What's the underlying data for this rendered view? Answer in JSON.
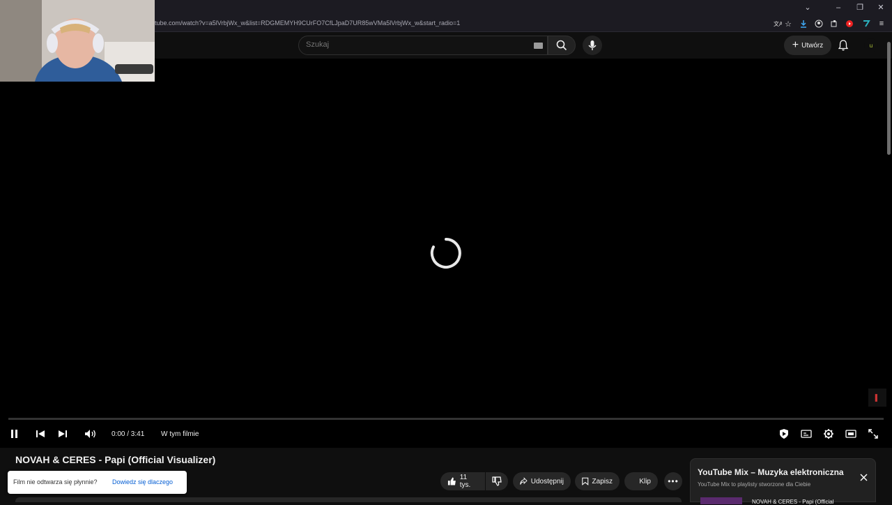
{
  "browser": {
    "url": "tube.com/watch?v=a5lVrbjWx_w&list=RDGMEMYH9CUrFO7CfLJpaD7UR85wVMa5lVrbjWx_w&start_radio=1",
    "icons": [
      "translate-icon",
      "star-icon",
      "download-icon",
      "account-icon",
      "extensions-icon",
      "youtube-ext-icon",
      "vpn-ext-icon",
      "menu-icon"
    ]
  },
  "header": {
    "search_placeholder": "Szukaj",
    "create_label": "Utwórz",
    "avatar_letter": "u"
  },
  "player": {
    "time": "0:00 / 3:41",
    "chapter": "W tym filmie",
    "progress": 0
  },
  "video": {
    "title": "NOVAH & CERES - Papi (Official Visualizer)",
    "likes": "11 tys.",
    "share_label": "Udostępnij",
    "save_label": "Zapisz",
    "clip_label": "Klip"
  },
  "toast": {
    "message": "Film nie odtwarza się płynnie?",
    "link": "Dowiedz się dlaczego"
  },
  "mix": {
    "title": "YouTube Mix – Muzyka elektroniczna",
    "subtitle": "YouTube Mix to playlisty stworzone dla Ciebie",
    "first_item": "NOVAH & CERES - Papi (Official"
  },
  "colors": {
    "background": "#0f0f0f",
    "accent": "#ff0000",
    "link": "#065fd4"
  }
}
